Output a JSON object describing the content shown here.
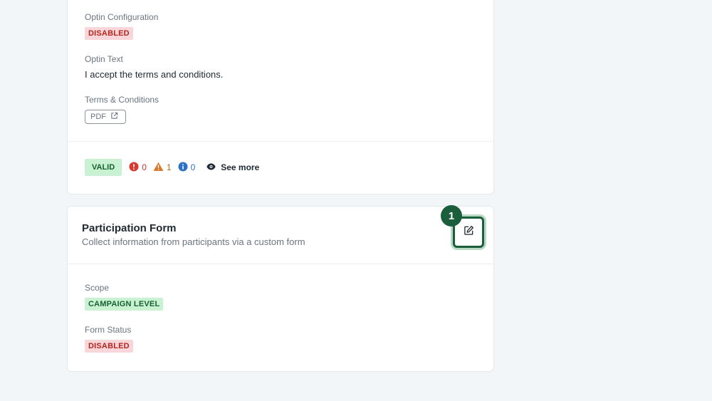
{
  "optin_card": {
    "optin_config_label": "Optin Configuration",
    "optin_config_status": "DISABLED",
    "optin_text_label": "Optin Text",
    "optin_text_value": "I accept the terms and conditions.",
    "terms_label": "Terms & Conditions",
    "terms_link_label": "PDF",
    "validation": {
      "status": "VALID",
      "errors": "0",
      "warnings": "1",
      "info": "0",
      "see_more_label": "See more"
    }
  },
  "participation_card": {
    "title": "Participation Form",
    "subtitle": "Collect information from participants via a custom form",
    "step_number": "1",
    "scope_label": "Scope",
    "scope_value": "CAMPAIGN LEVEL",
    "form_status_label": "Form Status",
    "form_status_value": "DISABLED"
  },
  "icons": {
    "external_link": "external-link-icon",
    "error": "error-icon",
    "warning": "warning-icon",
    "info": "info-icon",
    "eye": "eye-icon",
    "edit": "edit-icon"
  },
  "colors": {
    "accent_green": "#1a5e3b",
    "disabled_badge_bg": "#f9d6d9",
    "disabled_badge_text": "#b3261e",
    "enabled_badge_bg": "#c9f2d3",
    "enabled_badge_text": "#17612f"
  }
}
